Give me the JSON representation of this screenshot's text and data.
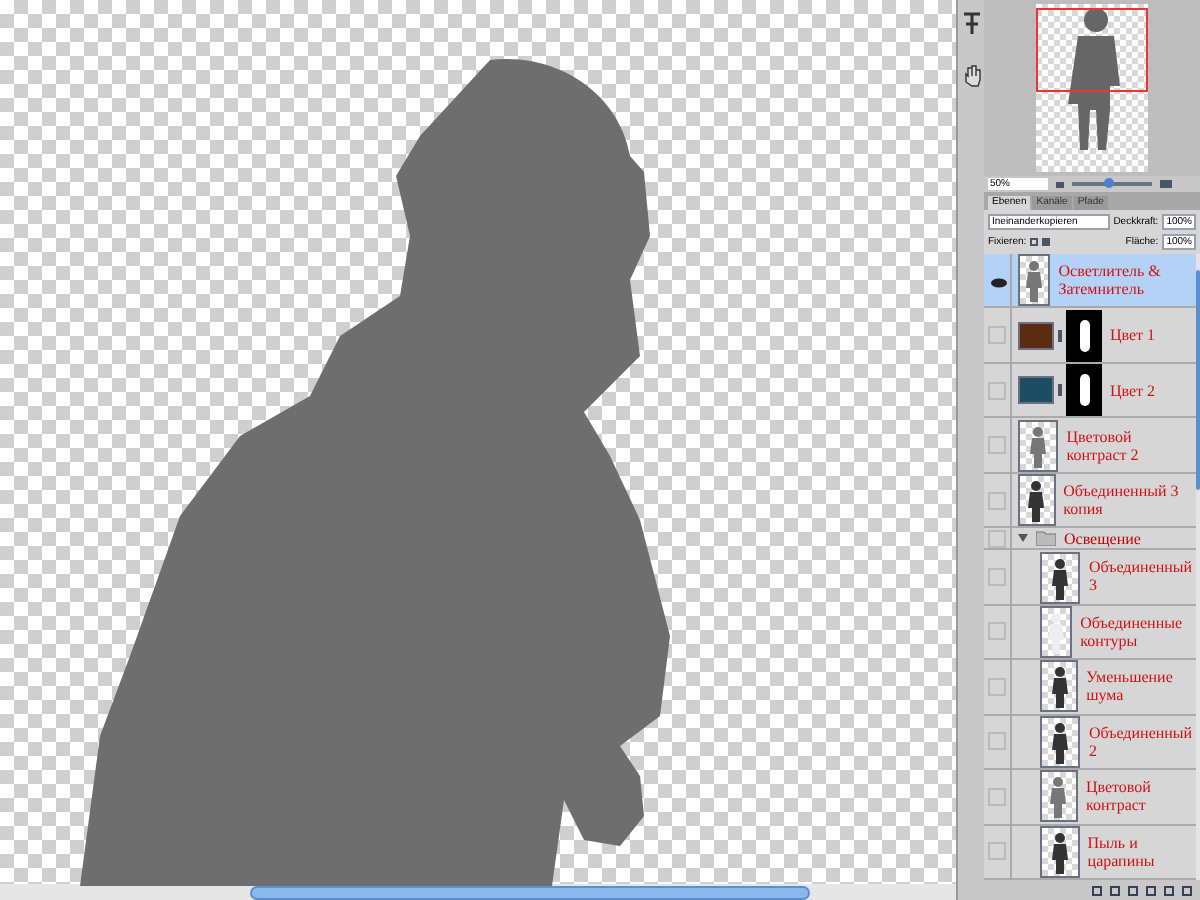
{
  "navigator": {
    "zoom": "50%",
    "level": 0.45
  },
  "layers_panel": {
    "tabs": [
      {
        "label": "Ebenen",
        "selected": true
      },
      {
        "label": "Kanäle",
        "selected": false
      },
      {
        "label": "Pfade",
        "selected": false
      }
    ],
    "blend_mode": "Ineinanderkopieren",
    "opacity_label": "Deckkraft:",
    "opacity": "100%",
    "lock_label": "Fixieren:",
    "fill_label": "Fläche:",
    "fill": "100%"
  },
  "layers": [
    {
      "kind": "image",
      "name": "Осветлитель & Затемнитель",
      "selected": true,
      "visible": true
    },
    {
      "kind": "fill",
      "name": "Цвет 1",
      "color": "#5a2a12",
      "selected": false,
      "visible": false
    },
    {
      "kind": "fill",
      "name": "Цвет 2",
      "color": "#1d4d63",
      "selected": false,
      "visible": false
    },
    {
      "kind": "image",
      "name": "Цветовой контраст 2",
      "selected": false,
      "visible": false
    },
    {
      "kind": "photo",
      "name": "Объединенный 3 копия",
      "selected": false,
      "visible": false
    },
    {
      "kind": "group",
      "name": "Освещение",
      "expanded": true,
      "selected": false,
      "visible": false,
      "children": [
        {
          "kind": "photo",
          "name": "Объединенный 3",
          "selected": false,
          "visible": false
        },
        {
          "kind": "blank",
          "name": "Объединенные контуры",
          "selected": false,
          "visible": false
        },
        {
          "kind": "photo",
          "name": "Уменьшение шума",
          "selected": false,
          "visible": false
        },
        {
          "kind": "photo",
          "name": "Объединенный 2",
          "selected": false,
          "visible": false
        },
        {
          "kind": "image",
          "name": "Цветовой контраст",
          "selected": false,
          "visible": false
        },
        {
          "kind": "photo",
          "name": "Пыль и царапины",
          "selected": false,
          "visible": false
        }
      ]
    }
  ]
}
